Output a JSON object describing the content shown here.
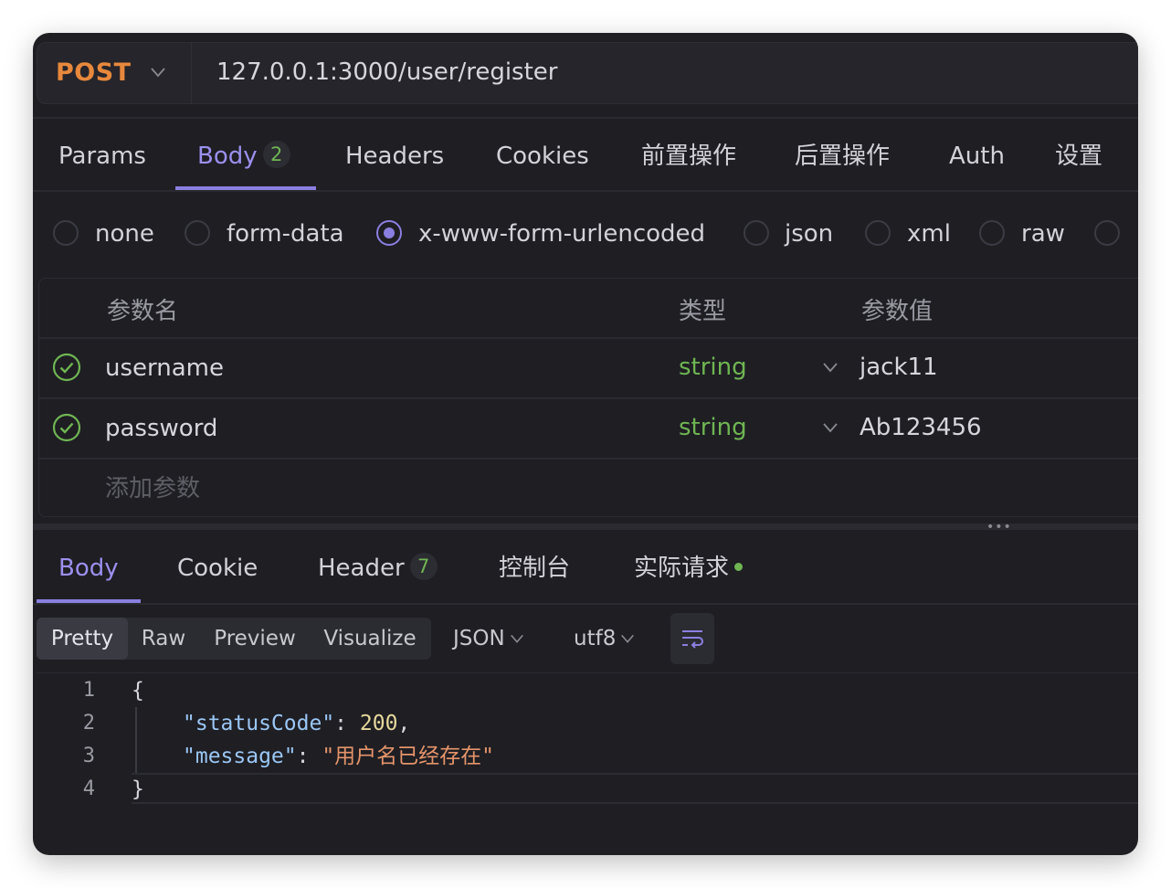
{
  "request": {
    "method": "POST",
    "url": "127.0.0.1:3000/user/register"
  },
  "request_tabs": [
    {
      "label": "Params"
    },
    {
      "label": "Body",
      "badge": "2"
    },
    {
      "label": "Headers"
    },
    {
      "label": "Cookies"
    },
    {
      "label": "前置操作"
    },
    {
      "label": "后置操作"
    },
    {
      "label": "Auth"
    },
    {
      "label": "设置"
    }
  ],
  "body_types": [
    {
      "label": "none",
      "selected": false
    },
    {
      "label": "form-data",
      "selected": false
    },
    {
      "label": "x-www-form-urlencoded",
      "selected": true
    },
    {
      "label": "json",
      "selected": false
    },
    {
      "label": "xml",
      "selected": false
    },
    {
      "label": "raw",
      "selected": false
    }
  ],
  "params_table": {
    "headers": {
      "name": "参数名",
      "type": "类型",
      "value": "参数值"
    },
    "rows": [
      {
        "name": "username",
        "type": "string",
        "value": "jack11",
        "enabled": true
      },
      {
        "name": "password",
        "type": "string",
        "value": "Ab123456",
        "enabled": true
      }
    ],
    "add_placeholder": "添加参数"
  },
  "response_tabs": [
    {
      "label": "Body"
    },
    {
      "label": "Cookie"
    },
    {
      "label": "Header",
      "badge": "7"
    },
    {
      "label": "控制台"
    },
    {
      "label": "实际请求"
    }
  ],
  "response_toolbar": {
    "views": [
      "Pretty",
      "Raw",
      "Preview",
      "Visualize"
    ],
    "format": "JSON",
    "encoding": "utf8"
  },
  "response_body": {
    "line_numbers": [
      "1",
      "2",
      "3",
      "4"
    ],
    "open_brace": "{",
    "close_brace": "}",
    "fields": [
      {
        "key": "\"statusCode\"",
        "value": "200",
        "trail": ","
      },
      {
        "key": "\"message\"",
        "value": "\"用户名已经存在\"",
        "trail": ""
      }
    ]
  },
  "colors": {
    "accent": "#8a7fe0",
    "method": "#e7883c",
    "success": "#6fb552",
    "background": "#1e1e23"
  },
  "icons": [
    "chevron-down-icon",
    "check-circle-icon",
    "wrap-lines-icon",
    "more-dots-icon"
  ]
}
